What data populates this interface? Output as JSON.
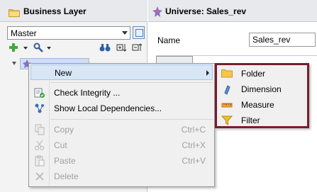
{
  "left_panel": {
    "title": "Business Layer",
    "selector": {
      "value": "Master"
    },
    "tree": {
      "node_label": ""
    }
  },
  "right_panel": {
    "title": "Universe: Sales_rev",
    "name_label": "Name",
    "name_value": "Sales_rev"
  },
  "context_menu": {
    "items": [
      {
        "label": "New",
        "shortcut": "",
        "enabled": true,
        "submenu": true,
        "icon": "none"
      },
      {
        "label": "Check Integrity ...",
        "shortcut": "",
        "enabled": true,
        "icon": "check-integrity-icon"
      },
      {
        "label": "Show Local Dependencies...",
        "shortcut": "",
        "enabled": true,
        "icon": "dependencies-icon"
      },
      {
        "label": "Copy",
        "shortcut": "Ctrl+C",
        "enabled": false,
        "icon": "copy-icon"
      },
      {
        "label": "Cut",
        "shortcut": "Ctrl+X",
        "enabled": false,
        "icon": "scissors-icon"
      },
      {
        "label": "Paste",
        "shortcut": "Ctrl+V",
        "enabled": false,
        "icon": "paste-icon"
      },
      {
        "label": "Delete",
        "shortcut": "",
        "enabled": false,
        "icon": "delete-icon"
      }
    ]
  },
  "submenu": {
    "border_color": "#7a1d2e",
    "items": [
      {
        "label": "Folder",
        "icon": "folder-icon"
      },
      {
        "label": "Dimension",
        "icon": "dimension-icon"
      },
      {
        "label": "Measure",
        "icon": "measure-icon"
      },
      {
        "label": "Filter",
        "icon": "filter-icon"
      }
    ]
  }
}
